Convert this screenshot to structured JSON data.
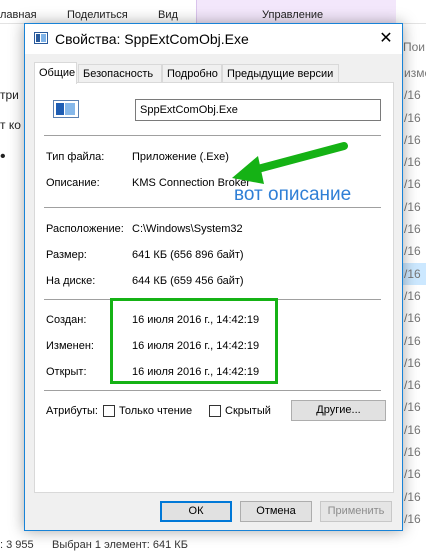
{
  "background": {
    "ribbon": [
      "лавная",
      "Поделиться",
      "Вид",
      "Управление"
    ],
    "left_texts": [
      "три",
      "т ко",
      "•"
    ],
    "right_header": "Пои",
    "right_rows": [
      "изме",
      "/16",
      "/16",
      "/16",
      "/16",
      "/16",
      "/16",
      "/16",
      "/16",
      "/16",
      "/16",
      "/16",
      "/16",
      "/16",
      "/16",
      "/16",
      "/16",
      "/16",
      "/16",
      "/16",
      "/16"
    ],
    "status_count": ": 3 955",
    "status_selected": "Выбран 1 элемент: 641 КБ"
  },
  "dialog": {
    "title": "Свойства: SppExtComObj.Exe",
    "close_symbol": "✕",
    "tabs": [
      "Общие",
      "Безопасность",
      "Подробно",
      "Предыдущие версии"
    ],
    "file_name": "SppExtComObj.Exe",
    "props": {
      "file_type_label": "Тип файла:",
      "file_type_value": "Приложение (.Exe)",
      "description_label": "Описание:",
      "description_value": "KMS Connection Broker",
      "location_label": "Расположение:",
      "location_value": "C:\\Windows\\System32",
      "size_label": "Размер:",
      "size_value": "641 КБ (656 896 байт)",
      "disk_label": "На диске:",
      "disk_value": "644 КБ (659 456 байт)",
      "created_label": "Создан:",
      "created_value": "16 июля 2016 г., 14:42:19",
      "modified_label": "Изменен:",
      "modified_value": "16 июля 2016 г., 14:42:19",
      "opened_label": "Открыт:",
      "opened_value": "16 июля 2016 г., 14:42:19"
    },
    "attributes_label": "Атрибуты:",
    "readonly_label": "Только чтение",
    "readonly_checked": false,
    "hidden_label": "Скрытый",
    "hidden_checked": false,
    "other_button": "Другие...",
    "ok_button": "ОК",
    "cancel_button": "Отмена",
    "apply_button": "Применить"
  },
  "annotation": {
    "text": "вот описание",
    "text_color": "#2f7fd6",
    "marker_color": "#15b215"
  },
  "colors": {
    "accent": "#1883d7",
    "dialog_bg": "#f0f0f0"
  }
}
